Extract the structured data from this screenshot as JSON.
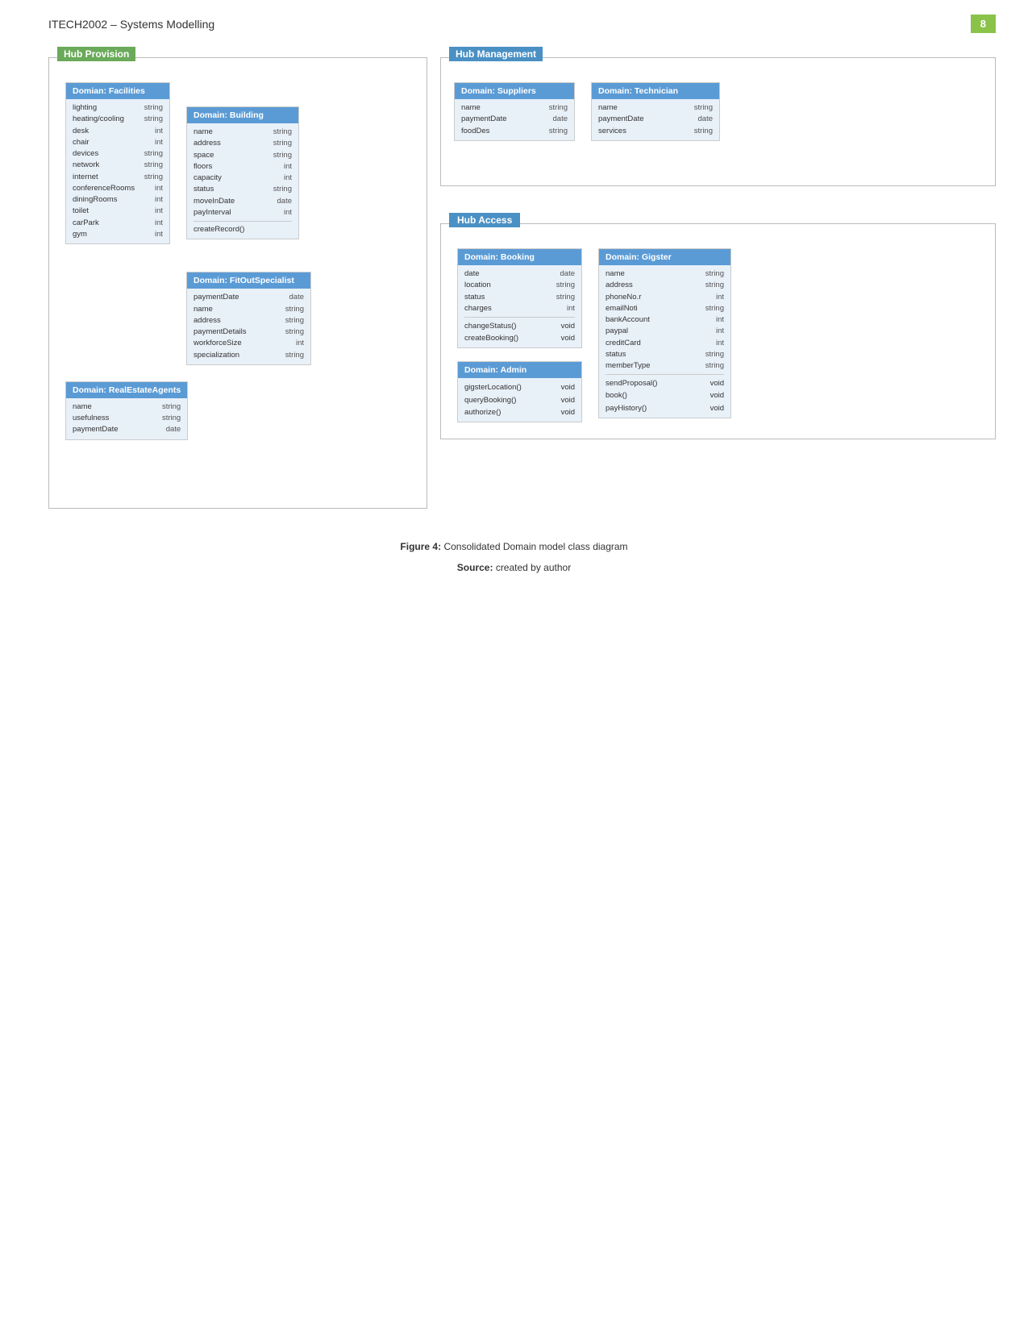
{
  "header": {
    "title": "ITECH2002 – Systems Modelling",
    "page_number": "8"
  },
  "sections": {
    "hub_provision": {
      "label": "Hub Provision",
      "color": "green"
    },
    "hub_management": {
      "label": "Hub Management",
      "color": "blue"
    },
    "hub_access": {
      "label": "Hub Access",
      "color": "blue"
    }
  },
  "domains": {
    "facilities": {
      "header": "Domian: Facilities",
      "attrs": [
        [
          "lighting",
          "string"
        ],
        [
          "heating/cooling",
          "string"
        ],
        [
          "desk",
          "int"
        ],
        [
          "chair",
          "int"
        ],
        [
          "devices",
          "string"
        ],
        [
          "network",
          "string"
        ],
        [
          "internet",
          "string"
        ],
        [
          "conferenceRooms",
          "int"
        ],
        [
          "diningRooms",
          "int"
        ],
        [
          "toilet",
          "int"
        ],
        [
          "carPark",
          "int"
        ],
        [
          "gym",
          "int"
        ]
      ]
    },
    "building": {
      "header": "Domain: Building",
      "attrs": [
        [
          "name",
          "string"
        ],
        [
          "address",
          "string"
        ],
        [
          "space",
          "string"
        ],
        [
          "floors",
          "int"
        ],
        [
          "capacity",
          "int"
        ],
        [
          "status",
          "string"
        ],
        [
          "moveInDate",
          "date"
        ],
        [
          "payInterval",
          "int"
        ]
      ],
      "methods": [
        [
          "createRecord()",
          ""
        ]
      ]
    },
    "real_estate_agents": {
      "header": "Domain: RealEstateAgents",
      "attrs": [
        [
          "name",
          "string"
        ],
        [
          "usefulness",
          "string"
        ],
        [
          "paymentDate",
          "date"
        ]
      ]
    },
    "fit_out_specialist": {
      "header": "Domain: FitOutSpecialist",
      "attrs": [
        [
          "paymentDate",
          "date"
        ],
        [
          "name",
          "string"
        ],
        [
          "address",
          "string"
        ],
        [
          "paymentDetails",
          "string"
        ],
        [
          "workforceSize",
          "int"
        ],
        [
          "specialization",
          "string"
        ]
      ]
    },
    "suppliers": {
      "header": "Domain: Suppliers",
      "attrs": [
        [
          "name",
          "string"
        ],
        [
          "paymentDate",
          "date"
        ],
        [
          "foodDes",
          "string"
        ]
      ]
    },
    "technician": {
      "header": "Domain: Technician",
      "attrs": [
        [
          "name",
          "string"
        ],
        [
          "paymentDate",
          "date"
        ],
        [
          "services",
          "string"
        ]
      ]
    },
    "booking": {
      "header": "Domain: Booking",
      "attrs": [
        [
          "date",
          "date"
        ],
        [
          "location",
          "string"
        ],
        [
          "status",
          "string"
        ],
        [
          "charges",
          "int"
        ]
      ],
      "methods": [
        [
          "changeStatus()",
          "void"
        ],
        [
          "createBooking()",
          "void"
        ]
      ]
    },
    "admin": {
      "header": "Domain: Admin",
      "methods": [
        [
          "gigsterLocation()",
          "void"
        ],
        [
          "queryBooking()",
          "void"
        ],
        [
          "authorize()",
          "void"
        ]
      ]
    },
    "gigster": {
      "header": "Domain: Gigster",
      "attrs": [
        [
          "name",
          "string"
        ],
        [
          "address",
          "string"
        ],
        [
          "phoneNo.r",
          "int"
        ],
        [
          "emailNoti",
          "string"
        ],
        [
          "bankAccount",
          "int"
        ],
        [
          "paypal",
          "int"
        ],
        [
          "creditCard",
          "int"
        ],
        [
          "status",
          "string"
        ],
        [
          "memberType",
          "string"
        ]
      ],
      "methods": [
        [
          "sendProposal()",
          "void"
        ],
        [
          "book()",
          "void"
        ],
        [
          "payHistory()",
          "void"
        ]
      ]
    }
  },
  "captions": {
    "figure": "Figure 4: Consolidated Domain model class diagram",
    "source": "Source: created by author",
    "figure_bold": "Figure 4:",
    "source_bold": "Source:"
  }
}
